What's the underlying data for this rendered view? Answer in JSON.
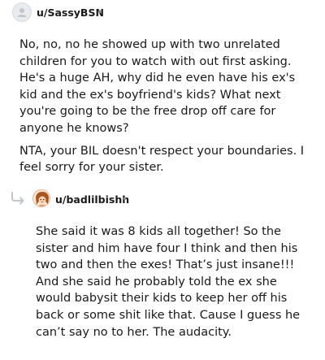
{
  "comment1": {
    "username": "u/SassyBSN",
    "separator": "•",
    "paragraphs": [
      "No, no, no he showed up with two unrelated children for you to watch with out first asking. He's a huge AH, why did he even have his ex's kid and the ex's boyfriend's kids? What next you're going to be the free drop off care for anyone he knows?",
      "NTA, your BIL doesn't respect your boundaries. I feel sorry for your sister."
    ]
  },
  "comment2": {
    "username": "u/badlilbishh",
    "separator": "•",
    "paragraphs": [
      "She said it was 8 kids all together! So the sister and him have four I think and then his two and then the exes! That’s just insane!!! And she said he probably told the ex she would babysit their kids to keep her off his back or some shit like that. Cause I guess he can’t say no to her. The audacity."
    ]
  },
  "icons": {
    "avatar1": "default-avatar-icon",
    "avatar2": "user-avatar-icon",
    "reply": "reply-arrow-icon"
  }
}
